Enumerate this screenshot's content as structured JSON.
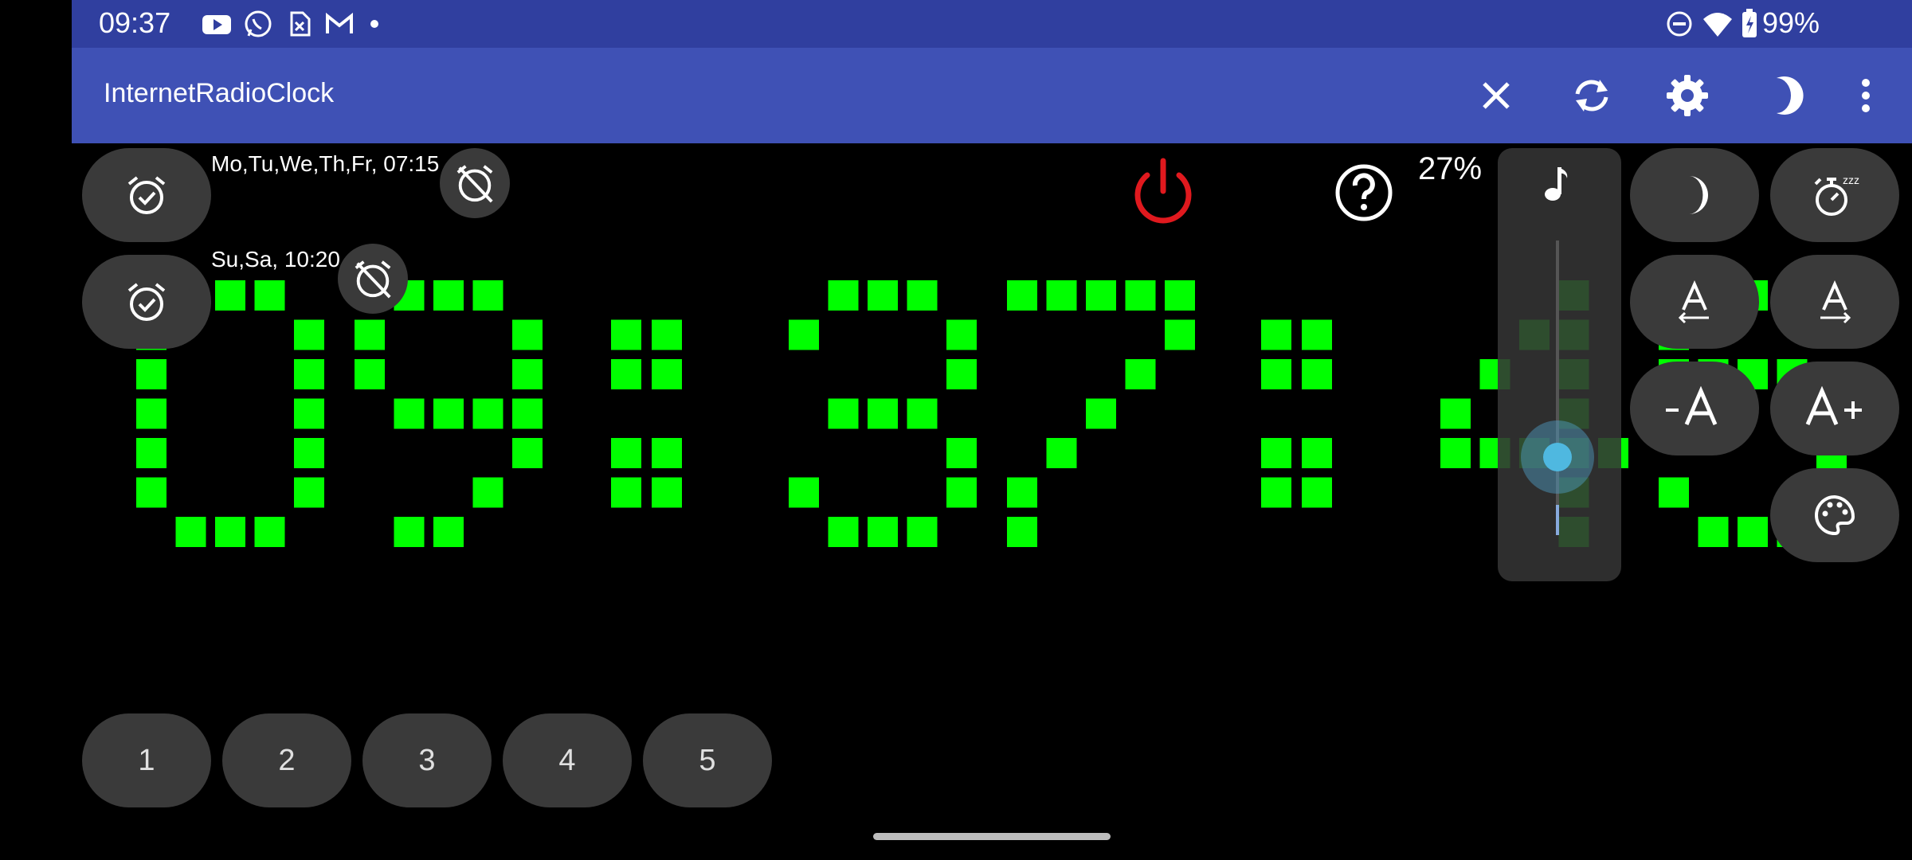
{
  "status_bar": {
    "time": "09:37",
    "battery": "99%",
    "left_icons": [
      "youtube-icon",
      "whatsapp-icon",
      "sim-card-icon",
      "gmail-icon",
      "dot-icon"
    ],
    "right_icons": [
      "do-not-disturb-icon",
      "wifi-icon",
      "battery-charging-icon"
    ]
  },
  "app_bar": {
    "title": "InternetRadioClock",
    "actions": [
      "close-icon",
      "sync-icon",
      "settings-icon",
      "night-mode-icon",
      "more-vert-icon"
    ]
  },
  "alarms": [
    {
      "label": "Mo,Tu,We,Th,Fr, 07:15",
      "enabled": true
    },
    {
      "label": "Su,Sa, 10:20",
      "enabled": true
    }
  ],
  "clock": {
    "text": "09:37:45",
    "color": "#00ff00"
  },
  "volume": {
    "percent_label": "27%",
    "level": 0.27
  },
  "presets": [
    "1",
    "2",
    "3",
    "4",
    "5"
  ],
  "colors": {
    "status_bar": "#303f9f",
    "app_bar": "#3f51b5",
    "power": "#e0191e",
    "accent": "#4fb8e0"
  }
}
